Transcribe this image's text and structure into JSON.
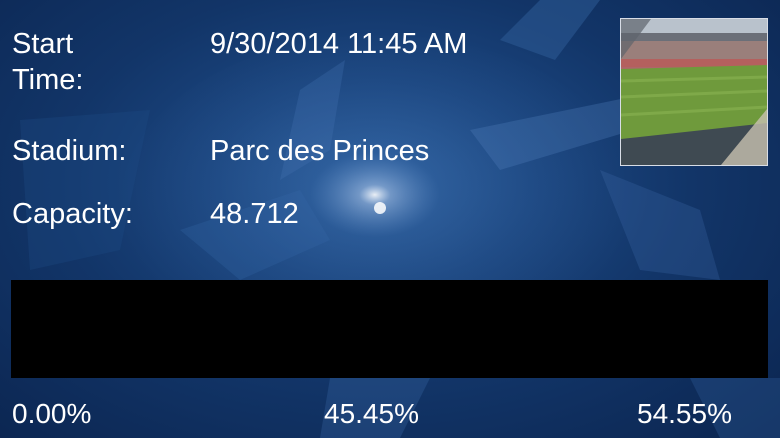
{
  "match_info": {
    "start_time_label": "Start Time:",
    "start_time_value": "9/30/2014 11:45 AM",
    "stadium_label": "Stadium:",
    "stadium_value": "Parc des Princes",
    "capacity_label": "Capacity:",
    "capacity_value": "48.712"
  },
  "prediction": {
    "home_pct": "0.00%",
    "draw_pct": "45.45%",
    "away_pct": "54.55%"
  },
  "colors": {
    "background": "#123568",
    "bar": "#000000",
    "text": "#ffffff"
  },
  "icons": {
    "stadium_photo": "stadium-photo"
  }
}
